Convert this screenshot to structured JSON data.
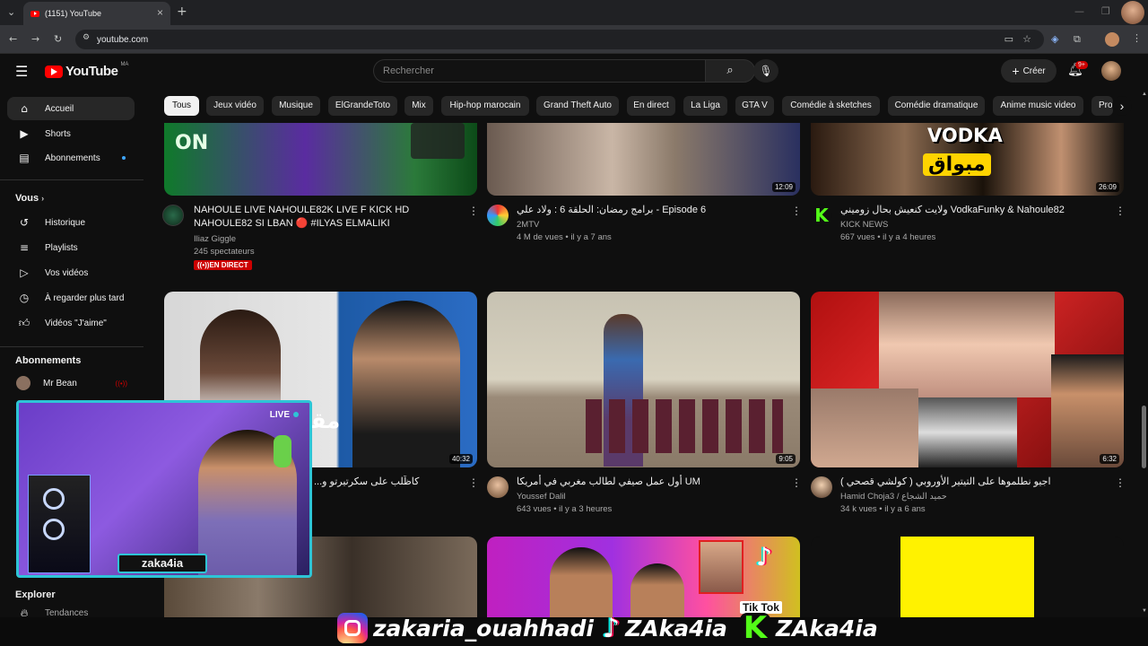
{
  "browser": {
    "tab_title": "(1151) YouTube",
    "url": "youtube.com",
    "new_tab": "+",
    "close_tab": "×"
  },
  "header": {
    "logo_text": "YouTube",
    "logo_country": "MA",
    "search_placeholder": "Rechercher",
    "create_label": "Créer",
    "notif_badge": "9+"
  },
  "sidebar": {
    "main": [
      {
        "label": "Accueil",
        "icon": "home-icon"
      },
      {
        "label": "Shorts",
        "icon": "shorts-icon"
      },
      {
        "label": "Abonnements",
        "icon": "subscriptions-icon"
      }
    ],
    "you_heading": "Vous",
    "you": [
      {
        "label": "Historique",
        "icon": "history-icon"
      },
      {
        "label": "Playlists",
        "icon": "playlists-icon"
      },
      {
        "label": "Vos vidéos",
        "icon": "your-videos-icon"
      },
      {
        "label": "À regarder plus tard",
        "icon": "watch-later-icon"
      },
      {
        "label": "Vidéos \"J'aime\"",
        "icon": "liked-icon"
      }
    ],
    "subs_heading": "Abonnements",
    "subs": [
      {
        "label": "Mr Bean"
      }
    ],
    "explore_heading": "Explorer",
    "explore": [
      {
        "label": "Tendances"
      }
    ]
  },
  "chips": [
    "Tous",
    "Jeux vidéo",
    "Musique",
    "ElGrandeToto",
    "Mix",
    "Hip-hop marocain",
    "Grand Theft Auto",
    "En direct",
    "La Liga",
    "GTA V",
    "Comédie à sketches",
    "Comédie dramatique",
    "Anime music video",
    "Pro"
  ],
  "videos": [
    {
      "title": "NAHOULE LIVE NAHOULE82K LIVE F KICK HD NAHOULE82 SI LBAN 🔴 #ILYAS ELMALIKI",
      "channel": "Iliaz Giggle",
      "meta": "245 spectateurs",
      "badge": "EN DIRECT",
      "duration": "",
      "thumb_text": "ON"
    },
    {
      "title": "برامج رمضان: الحلقة 6 : ولاد علي - Episode 6",
      "channel": "2MTV",
      "meta": "4 M de vues • il y a 7 ans",
      "duration": "12:09"
    },
    {
      "title": "ولايت كنعيش بحال زوميني VodkaFunky & Nahoule82",
      "channel": "KICK NEWS",
      "meta": "667 vues • il y a 4 heures",
      "duration": "26:09",
      "thumb_text": "VODKA",
      "thumb_text2": "مبواق"
    },
    {
      "title": "كاظّلب على سكرتيرتو و...",
      "channel": "",
      "meta": "",
      "duration": "40:32",
      "thumb_text": "مقا"
    },
    {
      "title": "أول عمل صيفي لطالب مغربي في أمريكا UM",
      "channel": "Youssef Dalil",
      "meta": "643 vues • il y a 3 heures",
      "duration": "9:05"
    },
    {
      "title": "اجيو نطلموها على التيتير الأوروبي ( كولشي قصحي )",
      "channel": "Hamid Choja3 / حميد الشجاع",
      "meta": "34 k vues • il y a 6 ans",
      "duration": "6:32"
    },
    {
      "title": "",
      "channel": "",
      "meta": "",
      "duration": ""
    },
    {
      "title": "",
      "channel": "",
      "meta": "",
      "duration": "",
      "thumb_text": "Tik Tok"
    },
    {
      "title": "",
      "channel": "",
      "meta": "",
      "duration": ""
    }
  ],
  "overlay": {
    "cam_name": "zaka4ia",
    "cam_live": "LIVE",
    "socials": [
      {
        "icon": "instagram-icon",
        "handle": "zakaria_ouahhadi"
      },
      {
        "icon": "tiktok-icon",
        "handle": "ZAka4ia"
      },
      {
        "icon": "kick-icon",
        "handle": "ZAka4ia"
      }
    ]
  },
  "colors": {
    "accent": "#ff0000",
    "kick": "#53fc18",
    "bg": "#0f0f0f"
  }
}
